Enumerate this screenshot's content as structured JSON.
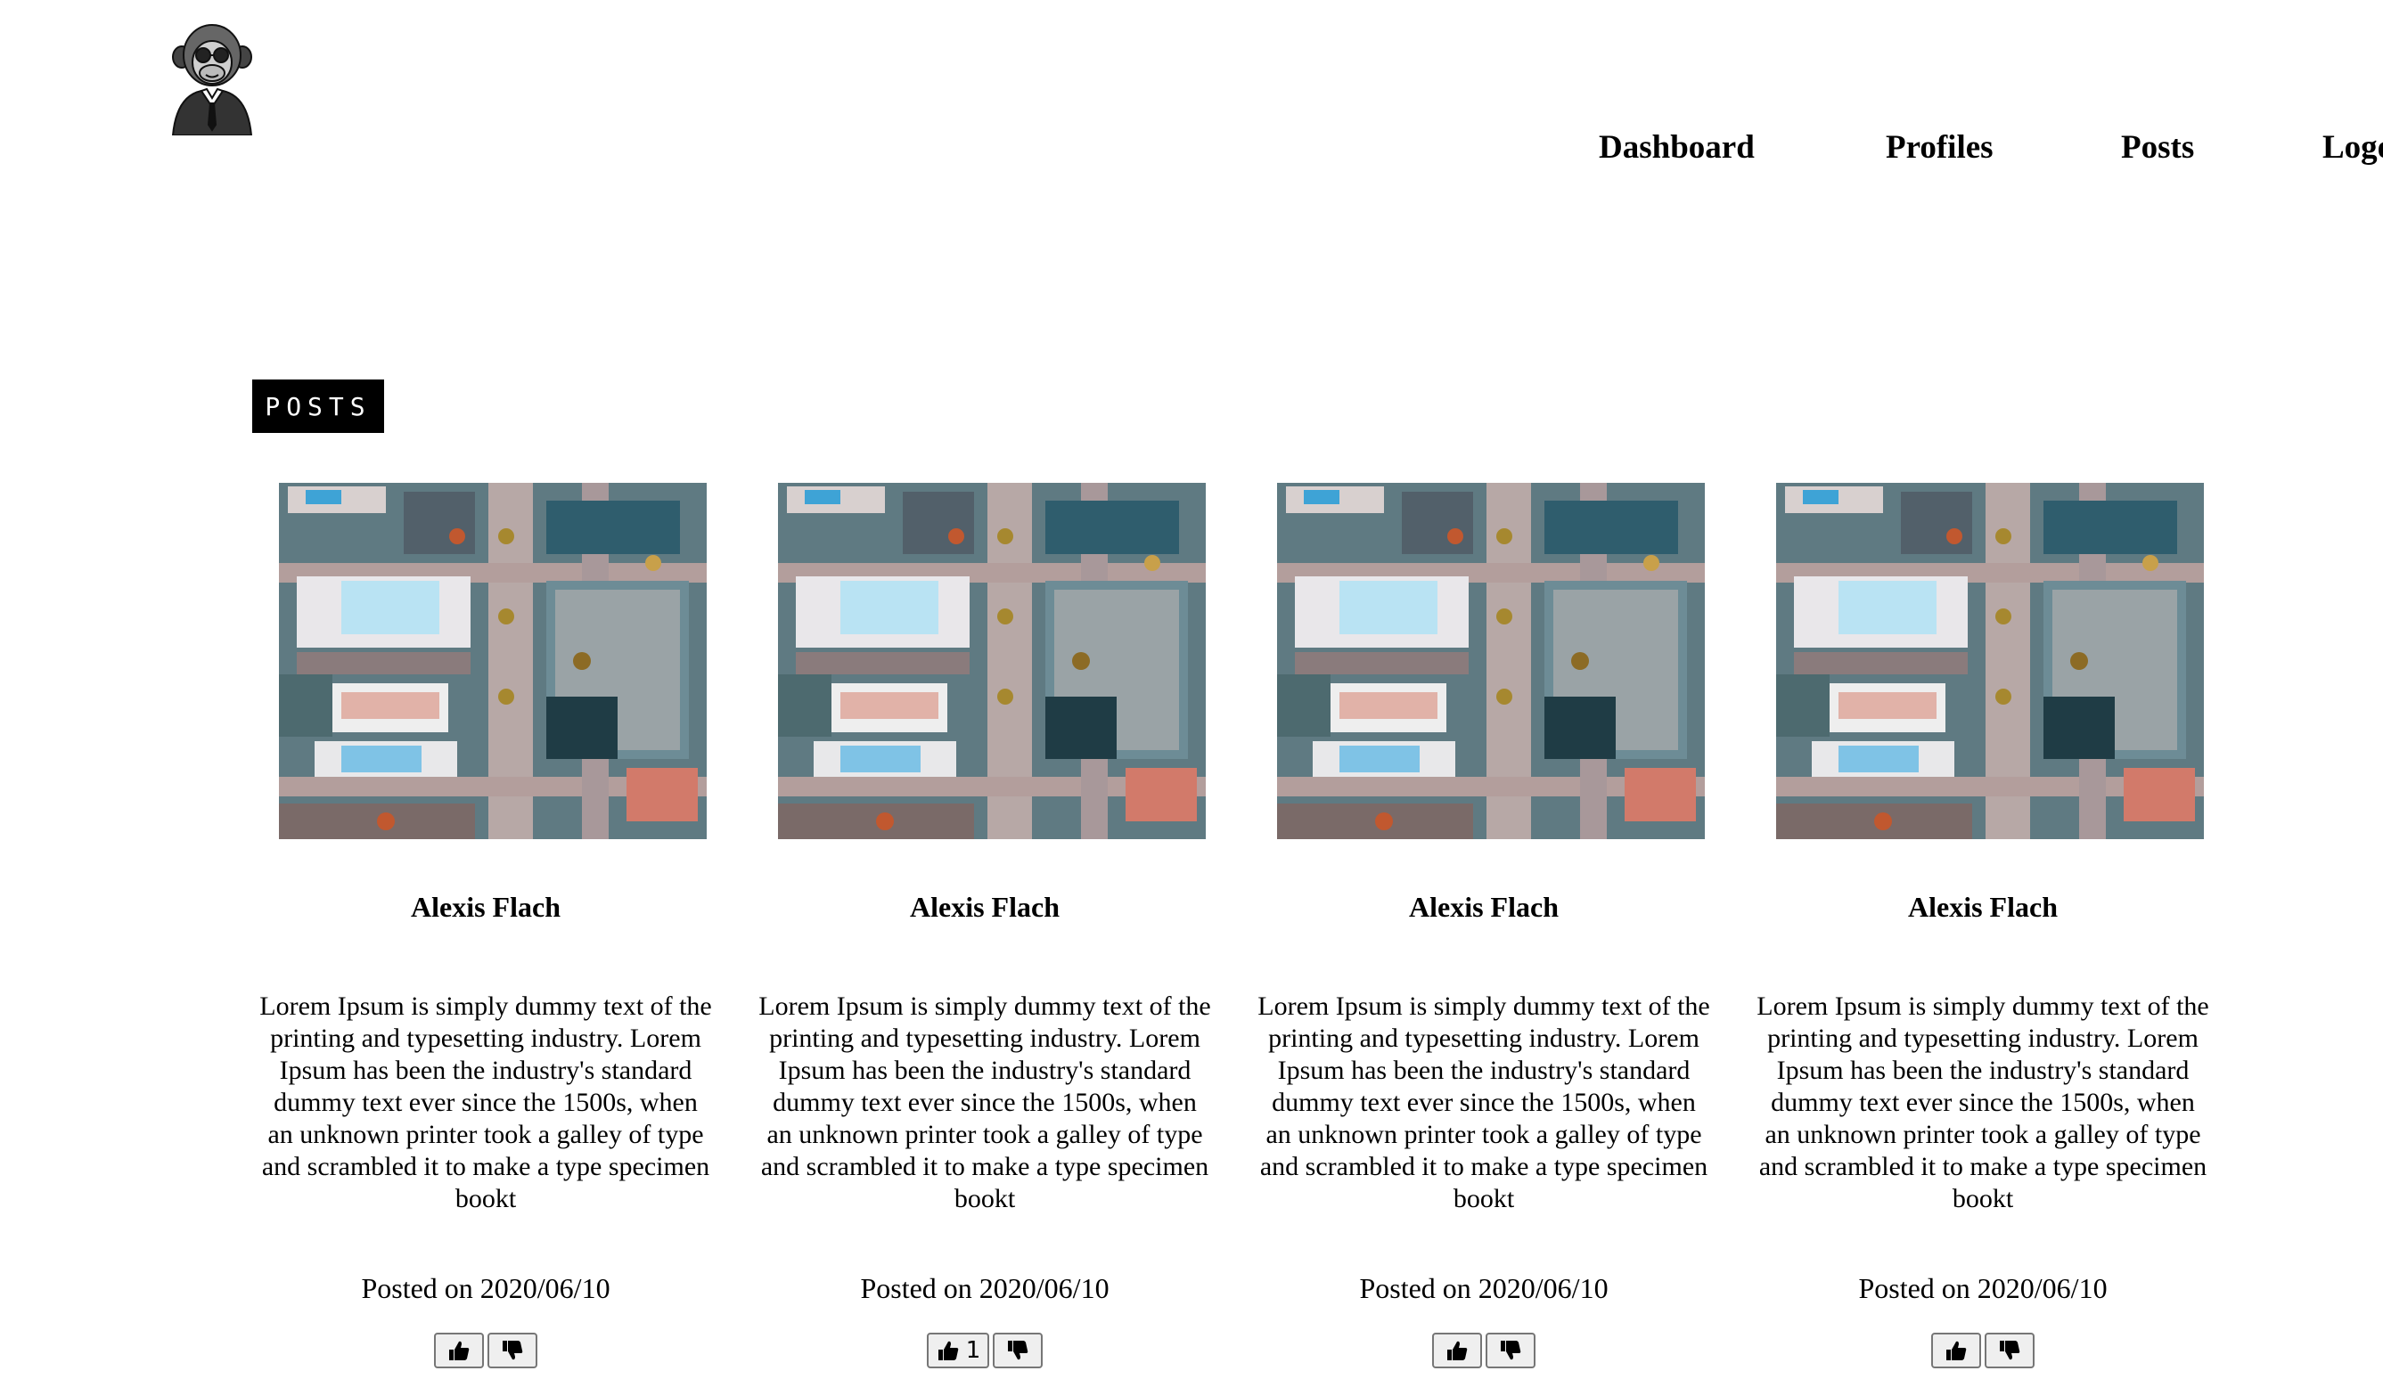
{
  "nav": {
    "items": [
      {
        "label": "Dashboard"
      },
      {
        "label": "Profiles"
      },
      {
        "label": "Posts"
      },
      {
        "label": "Logout"
      }
    ]
  },
  "section": {
    "title": "POSTS"
  },
  "posts": [
    {
      "author": "Alexis Flach",
      "body": "Lorem Ipsum is simply dummy text of the printing and typesetting industry. Lorem Ipsum has been the industry's standard dummy text ever since the 1500s, when an unknown printer took a galley of type and scrambled it to make a type specimen bookt",
      "date": "Posted on 2020/06/10",
      "likes": ""
    },
    {
      "author": "Alexis Flach",
      "body": "Lorem Ipsum is simply dummy text of the printing and typesetting industry. Lorem Ipsum has been the industry's standard dummy text ever since the 1500s, when an unknown printer took a galley of type and scrambled it to make a type specimen bookt",
      "date": "Posted on 2020/06/10",
      "likes": "1"
    },
    {
      "author": "Alexis Flach",
      "body": "Lorem Ipsum is simply dummy text of the printing and typesetting industry. Lorem Ipsum has been the industry's standard dummy text ever since the 1500s, when an unknown printer took a galley of type and scrambled it to make a type specimen bookt",
      "date": "Posted on 2020/06/10",
      "likes": ""
    },
    {
      "author": "Alexis Flach",
      "body": "Lorem Ipsum is simply dummy text of the printing and typesetting industry. Lorem Ipsum has been the industry's standard dummy text ever since the 1500s, when an unknown printer took a galley of type and scrambled it to make a type specimen bookt",
      "date": "Posted on 2020/06/10",
      "likes": ""
    }
  ],
  "icons": {
    "like": "thumbs-up-icon",
    "dislike": "thumbs-down-icon",
    "logo": "monkey-in-suit-logo"
  }
}
